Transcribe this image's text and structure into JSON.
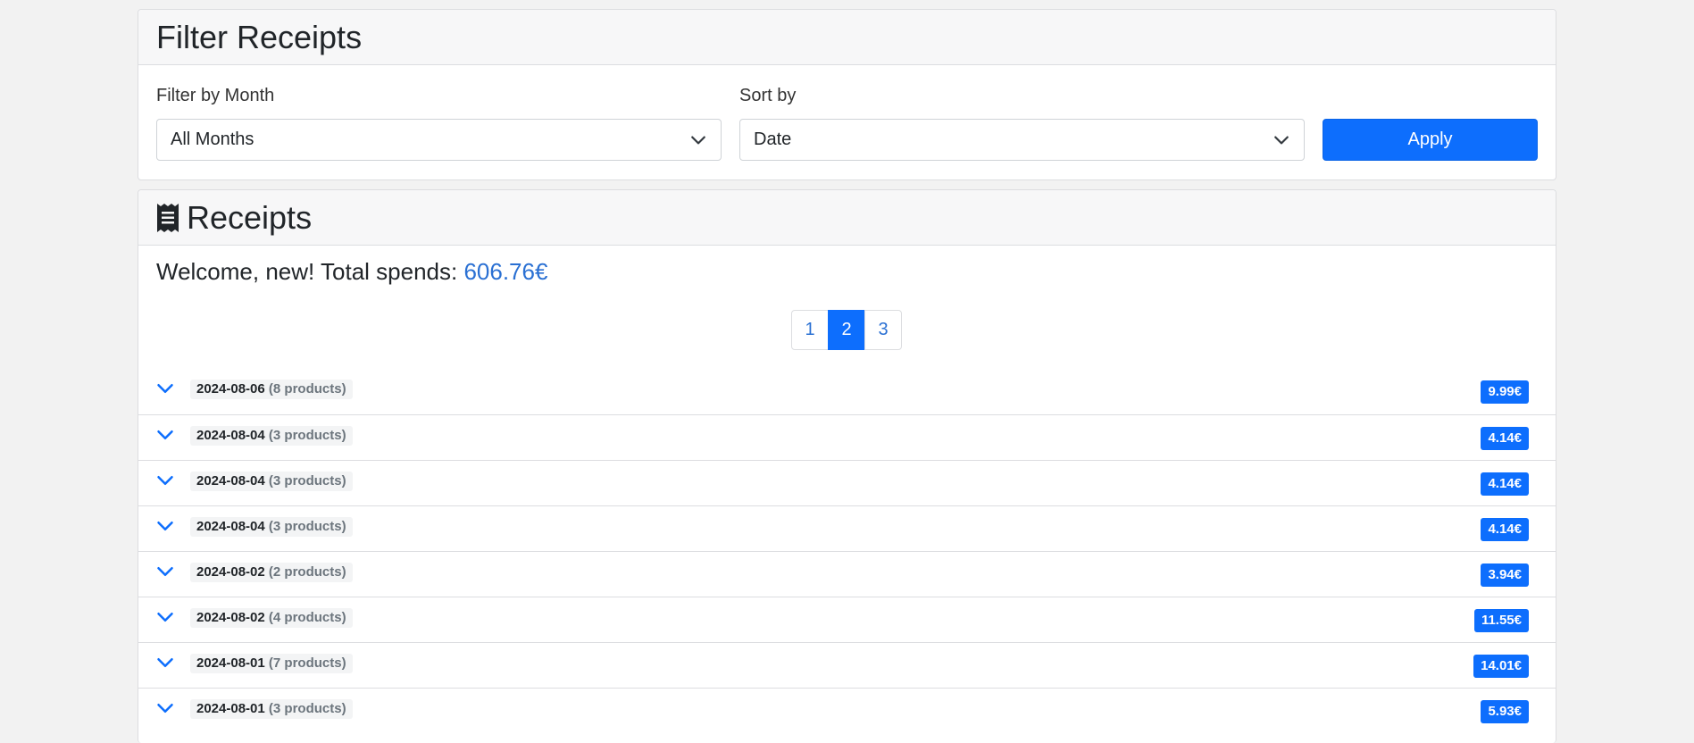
{
  "filter_card": {
    "title": "Filter Receipts",
    "month_label": "Filter by Month",
    "month_value": "All Months",
    "sort_label": "Sort by",
    "sort_value": "Date",
    "apply_label": "Apply"
  },
  "receipts_card": {
    "title": "Receipts",
    "icon": "receipt-icon",
    "welcome_text": "Welcome, new! Total spends: ",
    "total_spends": "606.76€",
    "pagination": {
      "pages": [
        "1",
        "2",
        "3"
      ],
      "active_page": "2"
    },
    "receipts": [
      {
        "date": "2024-08-06",
        "products": "(8 products)",
        "amount": "9.99€"
      },
      {
        "date": "2024-08-04",
        "products": "(3 products)",
        "amount": "4.14€"
      },
      {
        "date": "2024-08-04",
        "products": "(3 products)",
        "amount": "4.14€"
      },
      {
        "date": "2024-08-04",
        "products": "(3 products)",
        "amount": "4.14€"
      },
      {
        "date": "2024-08-02",
        "products": "(2 products)",
        "amount": "3.94€"
      },
      {
        "date": "2024-08-02",
        "products": "(4 products)",
        "amount": "11.55€"
      },
      {
        "date": "2024-08-01",
        "products": "(7 products)",
        "amount": "14.01€"
      },
      {
        "date": "2024-08-01",
        "products": "(3 products)",
        "amount": "5.93€"
      }
    ]
  },
  "colors": {
    "accent": "#0d6efd",
    "link": "#2a70d3",
    "background": "#f2f2f2"
  }
}
